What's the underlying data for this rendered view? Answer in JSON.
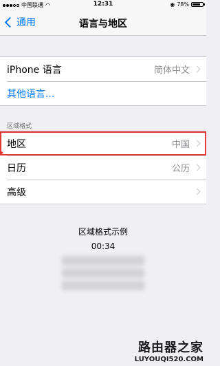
{
  "status_bar": {
    "carrier": "中国联通",
    "time": "12:31",
    "battery": "78%",
    "battery_level": 0.78
  },
  "nav": {
    "back_label": "通用",
    "title": "语言与地区"
  },
  "language_group": {
    "iphone_language_label": "iPhone 语言",
    "iphone_language_value": "简体中文",
    "other_languages_label": "其他语言..."
  },
  "region_section": {
    "header": "区域格式",
    "region_label": "地区",
    "region_value": "中国",
    "calendar_label": "日历",
    "calendar_value": "公历",
    "advanced_label": "高级"
  },
  "example": {
    "title": "区域格式示例",
    "time": "00:34"
  },
  "watermark": {
    "title": "路由器之家",
    "url": "LUYOUQI520.COM"
  },
  "colors": {
    "accent": "#007aff",
    "highlight": "#e53935",
    "background": "#efeff4"
  }
}
